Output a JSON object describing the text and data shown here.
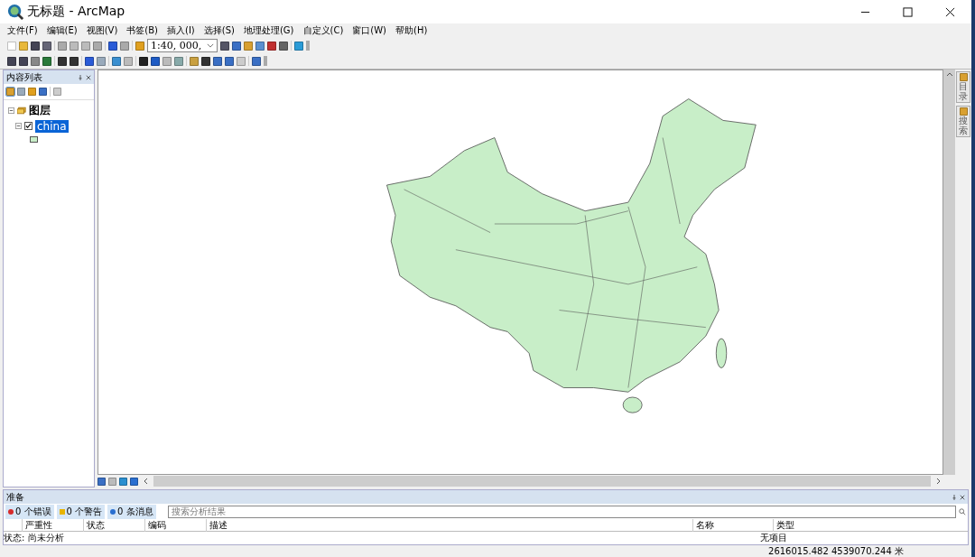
{
  "window": {
    "title": "无标题 - ArcMap"
  },
  "menu": [
    "文件(F)",
    "编辑(E)",
    "视图(V)",
    "书签(B)",
    "插入(I)",
    "选择(S)",
    "地理处理(G)",
    "自定义(C)",
    "窗口(W)",
    "帮助(H)"
  ],
  "toolbar": {
    "scale": "1:40, 000,"
  },
  "toc": {
    "title": "内容列表",
    "root": {
      "label": "图层",
      "expanded": true,
      "children": [
        {
          "label": "china",
          "checked": true,
          "selected": true,
          "expanded": true
        }
      ]
    }
  },
  "side_tabs": [
    "目录",
    "搜索"
  ],
  "analysis": {
    "title": "准备",
    "filters": [
      {
        "kind": "error",
        "label": "0 个错误"
      },
      {
        "kind": "warning",
        "label": "0 个警告"
      },
      {
        "kind": "info",
        "label": "0 条消息"
      }
    ],
    "search": {
      "placeholder": "搜索分析结果"
    },
    "columns": [
      "严重性",
      "状态",
      "编码",
      "描述",
      "名称",
      "类型"
    ],
    "status": "状态: 尚未分析",
    "empty": "无项目"
  },
  "status_bar": {
    "coordinates": "2616015.482  4539070.244 米"
  }
}
